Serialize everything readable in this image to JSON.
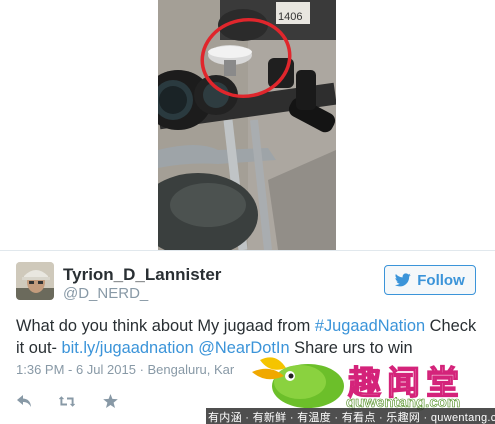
{
  "tweet": {
    "author": {
      "display_name": "Tyrion_D_Lannister",
      "handle": "@D_NERD_"
    },
    "follow_button": {
      "label": "Follow",
      "icon": "twitter-bird-icon"
    },
    "text": {
      "part1": "What do you think about My jugaad from ",
      "hashtag": "#JugaadNation",
      "part2": " Check it out- ",
      "link": "bit.ly/jugaadnation",
      "part3": " ",
      "mention": "@NearDotIn",
      "part4": " Share urs to win"
    },
    "timestamp": "1:36 PM - 6 Jul 2015 · Bengaluru, Kar",
    "actions": [
      {
        "name": "reply",
        "icon": "reply-icon"
      },
      {
        "name": "retweet",
        "icon": "retweet-icon"
      },
      {
        "name": "favorite",
        "icon": "star-icon"
      }
    ]
  },
  "photo": {
    "plate_text": "1406",
    "icon": "motorcycle-handlebar-photo"
  },
  "watermark": {
    "title": "趣闻堂",
    "domain": "quwentang.com",
    "strip_text": "有内涵 · 有新鲜 · 有温度 · 有看点 · 乐趣网 · quwentang.com"
  },
  "colors": {
    "link": "#3b94d9",
    "text": "#292f33",
    "muted": "#8899a6",
    "highlight_circle": "#e0262c",
    "watermark_magenta": "#d4237a",
    "watermark_green": "#6cbf2a"
  }
}
